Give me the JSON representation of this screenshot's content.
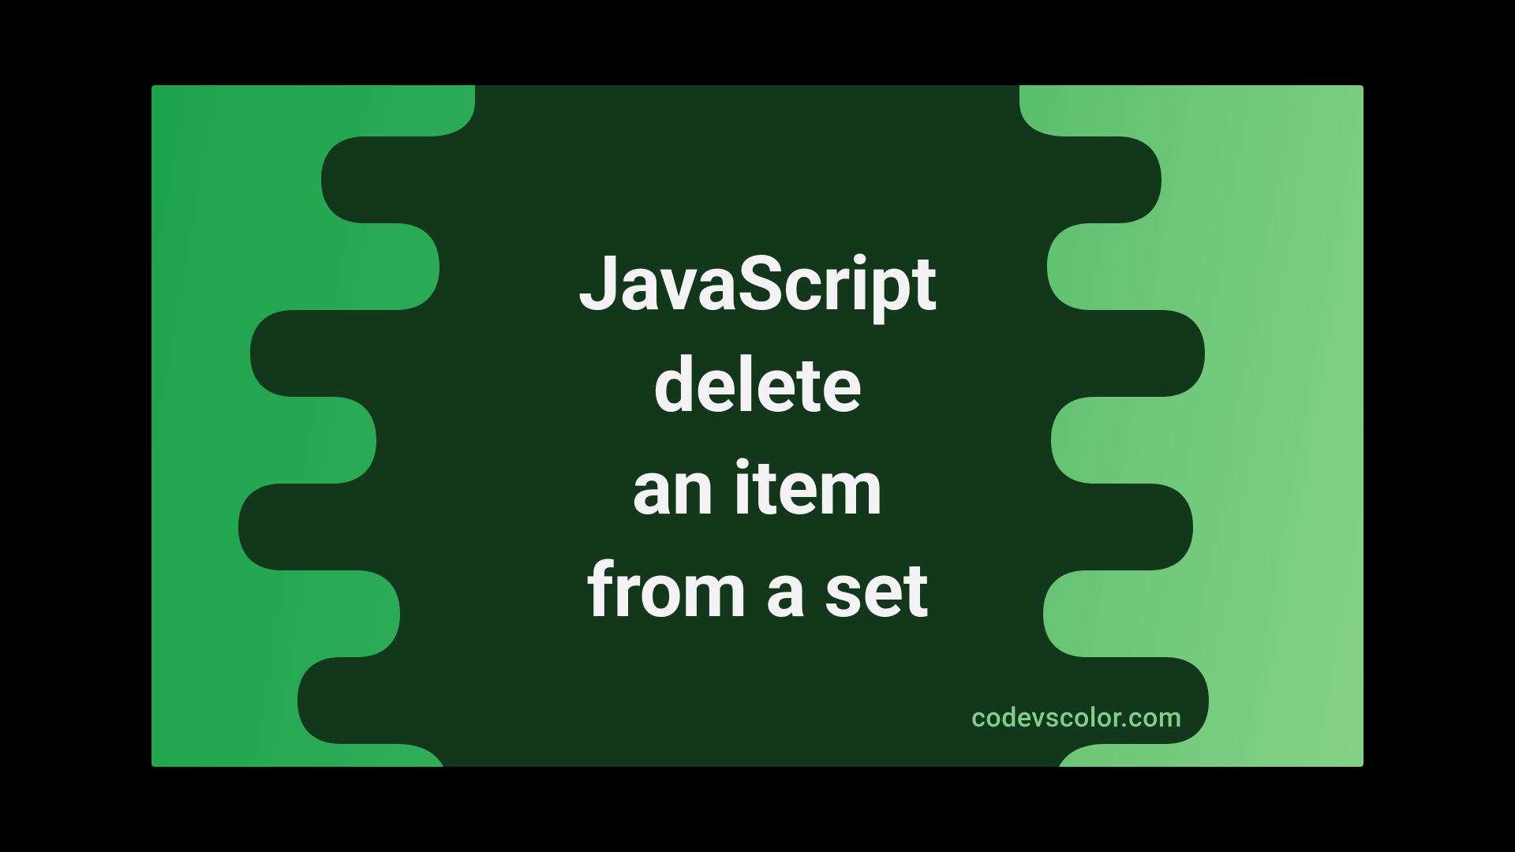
{
  "title": {
    "line1": "JavaScript",
    "line2": "delete",
    "line3": "an item",
    "line4": "from a set"
  },
  "brand": "codevscolor.com"
}
